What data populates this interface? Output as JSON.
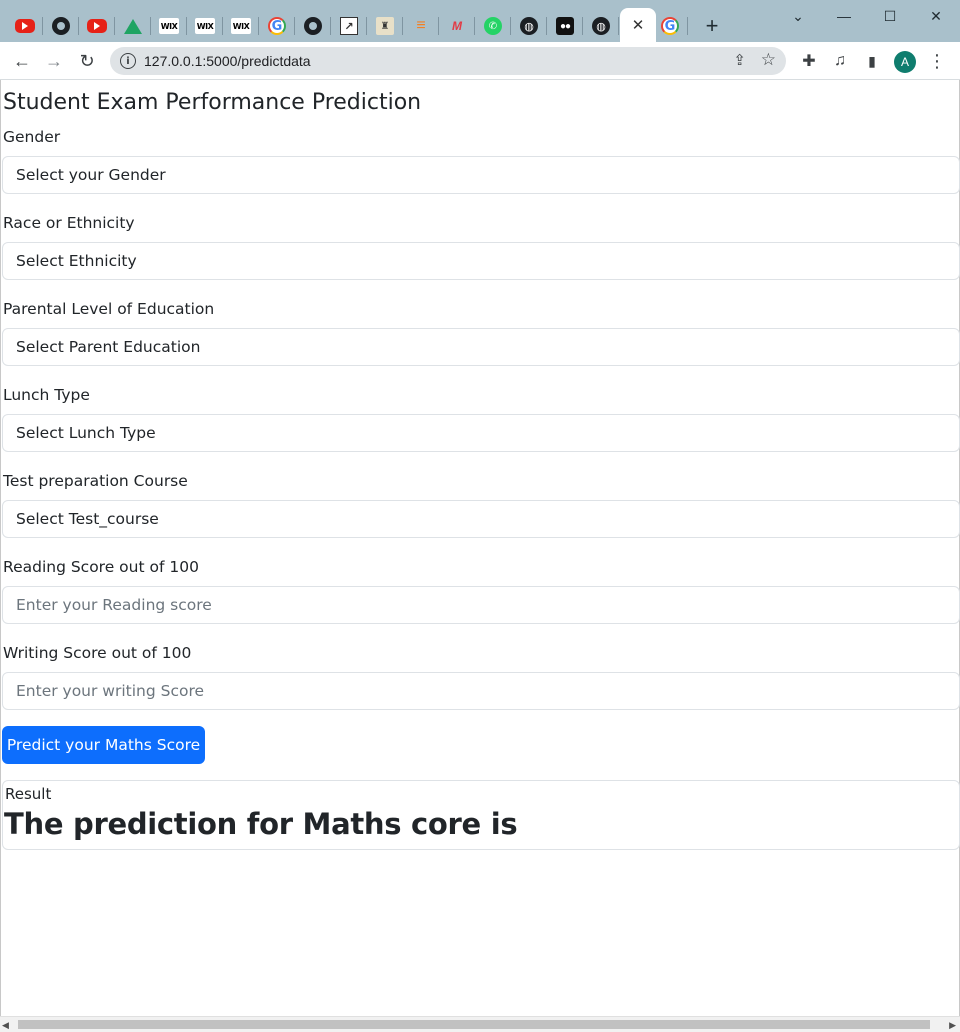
{
  "browser": {
    "tabs": [
      {
        "name": "youtube-tab",
        "icon": "youtube-icon",
        "glyph": ""
      },
      {
        "name": "github-tab",
        "icon": "github-icon",
        "glyph": ""
      },
      {
        "name": "youtube-tab-2",
        "icon": "youtube-icon",
        "glyph": ""
      },
      {
        "name": "google-drive-tab",
        "icon": "google-drive-icon",
        "glyph": ""
      },
      {
        "name": "wix-tab",
        "icon": "wix-icon",
        "glyph": "WIX"
      },
      {
        "name": "wix-tab-2",
        "icon": "wix-icon",
        "glyph": "WIX"
      },
      {
        "name": "wix-tab-3",
        "icon": "wix-icon",
        "glyph": "WIX"
      },
      {
        "name": "google-tab",
        "icon": "google-icon",
        "glyph": "G"
      },
      {
        "name": "github-tab-2",
        "icon": "github-icon",
        "glyph": ""
      },
      {
        "name": "chart-tab",
        "icon": "chart-icon",
        "glyph": "↗"
      },
      {
        "name": "person-tab",
        "icon": "person-icon",
        "glyph": "♜"
      },
      {
        "name": "stackoverflow-tab",
        "icon": "stackoverflow-icon",
        "glyph": "≡"
      },
      {
        "name": "m-tab",
        "icon": "m-logo-icon",
        "glyph": "M"
      },
      {
        "name": "whatsapp-tab",
        "icon": "whatsapp-icon",
        "glyph": "✆"
      },
      {
        "name": "globe-tab",
        "icon": "globe-icon",
        "glyph": "◍"
      },
      {
        "name": "medium-tab",
        "icon": "medium-icon",
        "glyph": "●●"
      },
      {
        "name": "globe-tab-2",
        "icon": "globe-icon",
        "glyph": "◍"
      }
    ],
    "active_tab_close": "✕",
    "last_tab_glyph": "G",
    "new_tab": "+",
    "window": {
      "chevron": "⌄",
      "minimize": "—",
      "maximize": "☐",
      "close": "✕"
    },
    "nav": {
      "back": "←",
      "forward": "→",
      "reload": "↻"
    },
    "url": "127.0.0.1:5000/predictdata",
    "info_icon": "i",
    "share_icon": "⇪",
    "star_icon": "☆",
    "toolbar_icons": {
      "extensions": "✚",
      "media": "♫",
      "sidepanel": "▮",
      "menu": "⋮"
    },
    "profile_initial": "A"
  },
  "page": {
    "title": "Student Exam Performance Prediction",
    "fields": [
      {
        "label": "Gender",
        "kind": "select",
        "value": "Select your Gender"
      },
      {
        "label": "Race or Ethnicity",
        "kind": "select",
        "value": "Select Ethnicity"
      },
      {
        "label": "Parental Level of Education",
        "kind": "select",
        "value": "Select Parent Education"
      },
      {
        "label": "Lunch Type",
        "kind": "select",
        "value": "Select Lunch Type"
      },
      {
        "label": "Test preparation Course",
        "kind": "select",
        "value": "Select Test_course"
      },
      {
        "label": "Reading Score out of 100",
        "kind": "input",
        "placeholder": "Enter your Reading score"
      },
      {
        "label": "Writing Score out of 100",
        "kind": "input",
        "placeholder": "Enter your writing Score"
      }
    ],
    "submit_label": "Predict your Maths Score",
    "result": {
      "label": "Result",
      "text": "The prediction for Maths core is"
    }
  },
  "scrollbar": {
    "left_arrow": "◀",
    "right_arrow": "▶"
  }
}
